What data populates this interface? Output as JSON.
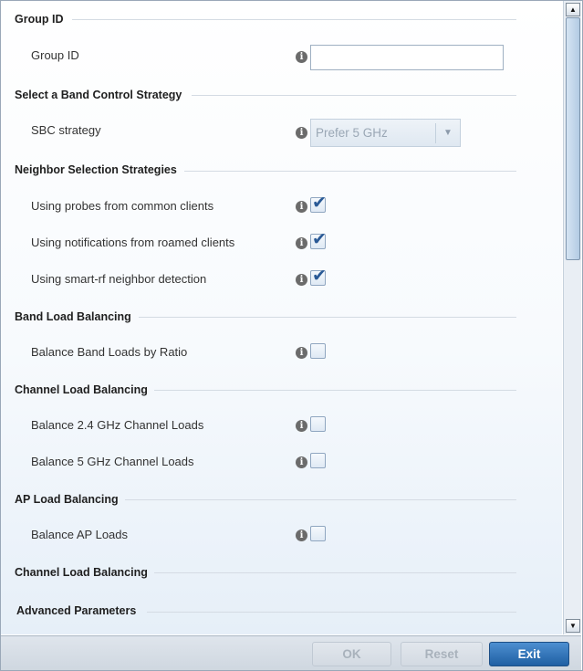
{
  "sections": {
    "group_id": "Group ID",
    "band_control": "Select a Band Control Strategy",
    "neighbor": "Neighbor Selection Strategies",
    "band_load": "Band Load Balancing",
    "channel_load": "Channel Load Balancing",
    "ap_load": "AP Load Balancing",
    "channel_load_2": "Channel Load Balancing",
    "advanced": "Advanced Parameters"
  },
  "fields": {
    "group_id_label": "Group ID",
    "group_id_value": "",
    "sbc_label": "SBC strategy",
    "sbc_value": "Prefer 5 GHz",
    "probes_label": "Using probes from common clients",
    "notifications_label": "Using notifications from roamed clients",
    "smartrf_label": "Using smart-rf neighbor detection",
    "band_ratio_label": "Balance Band Loads by Ratio",
    "ch24_label": "Balance 2.4 GHz Channel Loads",
    "ch5_label": "Balance 5 GHz Channel Loads",
    "ap_loads_label": "Balance AP Loads"
  },
  "checkboxes": {
    "probes": true,
    "notifications": true,
    "smartrf": true,
    "band_ratio": false,
    "ch24": false,
    "ch5": false,
    "ap_loads": false
  },
  "info_glyph": "i",
  "check_glyph": "✔",
  "scroll": {
    "up_glyph": "▲",
    "down_glyph": "▼"
  },
  "buttons": {
    "ok": "OK",
    "reset": "Reset",
    "exit": "Exit"
  },
  "colors": {
    "accent": "#1f5fa3",
    "section_line": "#d4dbe3"
  }
}
